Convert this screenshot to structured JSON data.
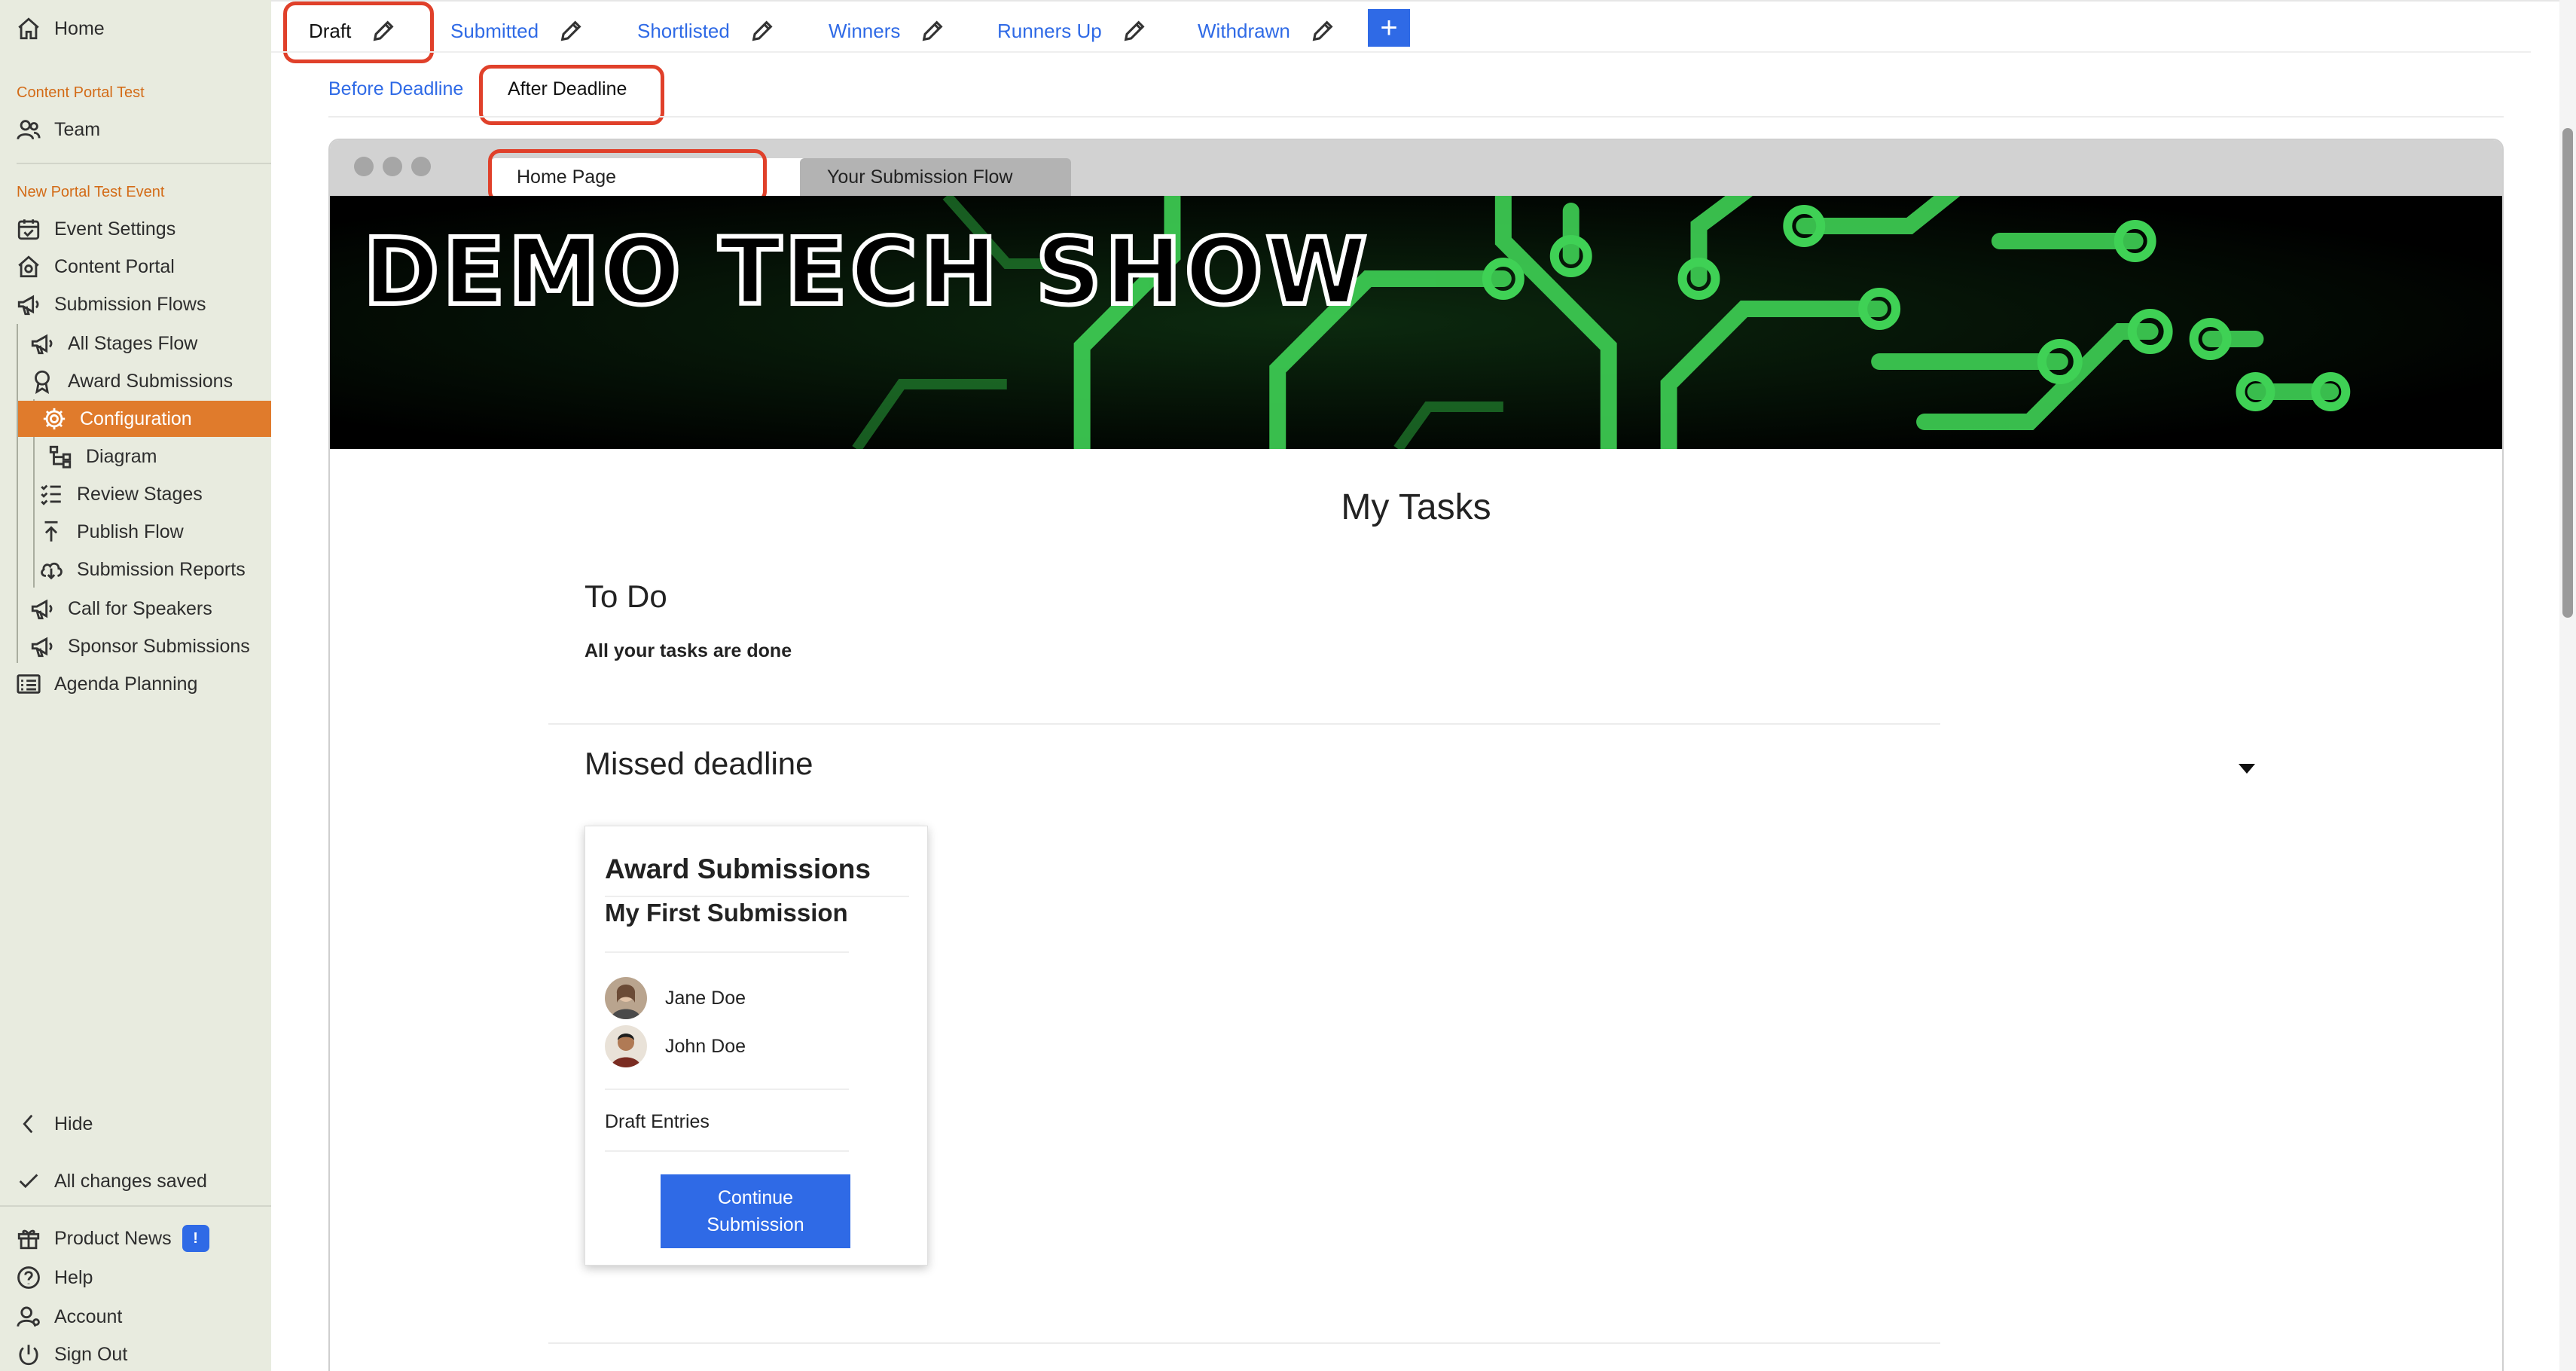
{
  "sidebar": {
    "home": "Home",
    "org_heading": "Content Portal Test",
    "team": "Team",
    "event_heading": "New Portal Test Event",
    "items": {
      "event_settings": "Event Settings",
      "content_portal": "Content Portal",
      "submission_flows": "Submission Flows",
      "all_stages_flow": "All Stages Flow",
      "award_submissions": "Award Submissions",
      "configuration": "Configuration",
      "diagram": "Diagram",
      "review_stages": "Review Stages",
      "publish_flow": "Publish Flow",
      "submission_reports": "Submission Reports",
      "call_for_speakers": "Call for Speakers",
      "sponsor_submissions": "Sponsor Submissions",
      "agenda_planning": "Agenda Planning"
    },
    "hide": "Hide",
    "saved": "All changes saved",
    "product_news": "Product News",
    "product_news_badge": "!",
    "help": "Help",
    "account": "Account",
    "sign_out": "Sign Out"
  },
  "status_tabs": [
    "Draft",
    "Submitted",
    "Shortlisted",
    "Winners",
    "Runners Up",
    "Withdrawn"
  ],
  "add_tab_label": "+",
  "sub_tabs": [
    "Before Deadline",
    "After Deadline"
  ],
  "preview": {
    "tabs": [
      "Home Page",
      "Your Submission Flow"
    ],
    "banner_title": "DEMO TECH SHOW",
    "heading": "My Tasks",
    "todo_title": "To Do",
    "todo_message": "All your tasks are done",
    "missed_title": "Missed deadline",
    "card": {
      "flow": "Award Submissions",
      "title": "My First Submission",
      "people": [
        "Jane Doe",
        "John Doe"
      ],
      "stage": "Draft Entries",
      "button_line1": "Continue",
      "button_line2": "Submission"
    }
  },
  "colors": {
    "accent": "#2f6ae6",
    "active_nav": "#e07b2c",
    "section_heading": "#d36b17",
    "highlight_ring": "#e0402a",
    "sidebar_bg": "#e8ebdf",
    "banner_green": "#3fd155"
  }
}
